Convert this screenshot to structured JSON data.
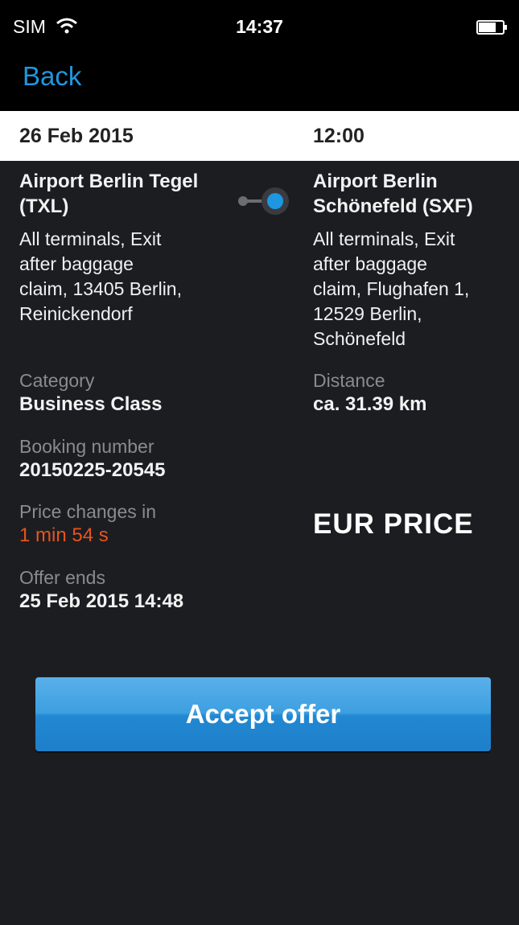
{
  "status_bar": {
    "carrier": "SIM",
    "time": "14:37"
  },
  "nav": {
    "back_label": "Back"
  },
  "date_bar": {
    "date": "26 Feb 2015",
    "time": "12:00"
  },
  "route": {
    "origin": {
      "name_line1": "Airport Berlin Tegel",
      "name_line2": "(TXL)",
      "address_line1": "All terminals, Exit",
      "address_line2": "after baggage",
      "address_line3": "claim, 13405 Berlin,",
      "address_line4": "Reinickendorf"
    },
    "destination": {
      "name_line1": "Airport Berlin",
      "name_line2": "Schönefeld (SXF)",
      "address_line1": "All terminals, Exit",
      "address_line2": "after baggage",
      "address_line3": "claim, Flughafen 1,",
      "address_line4": "12529 Berlin,",
      "address_line5": "Schönefeld"
    }
  },
  "details": {
    "category_label": "Category",
    "category_value": "Business Class",
    "distance_label": "Distance",
    "distance_value": "ca. 31.39 km",
    "booking_label": "Booking number",
    "booking_value": "20150225-20545",
    "price_change_label": "Price changes in",
    "price_change_value": "1 min 54 s",
    "offer_ends_label": "Offer ends",
    "offer_ends_value": "25 Feb 2015 14:48",
    "price": "EUR PRICE"
  },
  "actions": {
    "accept_label": "Accept offer"
  },
  "colors": {
    "accent": "#1e97e0",
    "warning": "#e8541e",
    "background": "#1c1d21"
  },
  "icons": {
    "wifi": "wifi-icon",
    "battery": "battery-icon",
    "route": "route-toggle-icon"
  }
}
